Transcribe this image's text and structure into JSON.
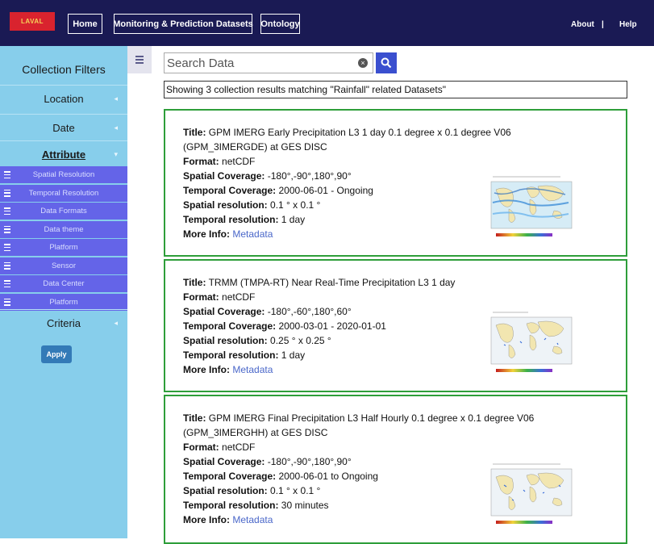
{
  "nav": {
    "logo_text": "LAVAL",
    "home": "Home",
    "monitoring": "Monitoring & Prediction Datasets",
    "ontology": "Ontology",
    "about": "About",
    "separator": "|",
    "help": "Help"
  },
  "sidebar": {
    "title": "Collection Filters",
    "location": "Location",
    "date": "Date",
    "attribute": "Attribute",
    "criteria": "Criteria",
    "sub_items": [
      "Spatial Resolution",
      "Temporal Resolution",
      "Data Formats",
      "Data theme",
      "Platform",
      "Sensor",
      "Data Center",
      "Platform"
    ],
    "apply": "Apply"
  },
  "search": {
    "placeholder": "Search Data",
    "clear_icon": "x-circle-icon",
    "search_icon": "magnifier-icon"
  },
  "results_banner": "Showing 3 collection results matching \"Rainfall\" related Datasets\"",
  "labels": {
    "title": "Title:",
    "format": "Format:",
    "spatial_coverage": "Spatial Coverage:",
    "temporal_coverage": "Temporal Coverage:",
    "spatial_resolution": "Spatial resolution:",
    "temporal_resolution": "Temporal resolution:",
    "more_info": "More Info:"
  },
  "cards": [
    {
      "title": "GPM IMERG Early Precipitation L3 1 day 0.1 degree x 0.1 degree V06 (GPM_3IMERGDE) at GES DISC",
      "format": "netCDF",
      "spatial_coverage": "-180°,-90°,180°,90°",
      "temporal_coverage": "2000-06-01 - Ongoing",
      "spatial_resolution": "0.1 ° x 0.1 °",
      "temporal_resolution": "1 day",
      "more_info": "Metadata"
    },
    {
      "title": "TRMM (TMPA-RT) Near Real-Time Precipitation L3 1 day",
      "format": "netCDF",
      "spatial_coverage": "-180°,-60°,180°,60°",
      "temporal_coverage": "2000-03-01 - 2020-01-01",
      "spatial_resolution": "0.25 ° x 0.25 °",
      "temporal_resolution": "1 day",
      "more_info": "Metadata"
    },
    {
      "title": "GPM IMERG Final Precipitation L3 Half Hourly 0.1 degree x 0.1 degree V06 (GPM_3IMERGHH) at GES DISC",
      "format": "netCDF",
      "spatial_coverage": "-180°,-90°,180°,90°",
      "temporal_coverage": "2000-06-01 to Ongoing",
      "spatial_resolution": "0.1 ° x 0.1 °",
      "temporal_resolution": "30 minutes",
      "more_info": "Metadata"
    }
  ],
  "colors": {
    "nav_bg": "#1a1a54",
    "sidebar_bg": "#87ceeb",
    "sub_item_bg": "#6464e8",
    "card_border": "#2e9e3a",
    "link": "#4a67c9",
    "search_button": "#3a4fcf"
  }
}
